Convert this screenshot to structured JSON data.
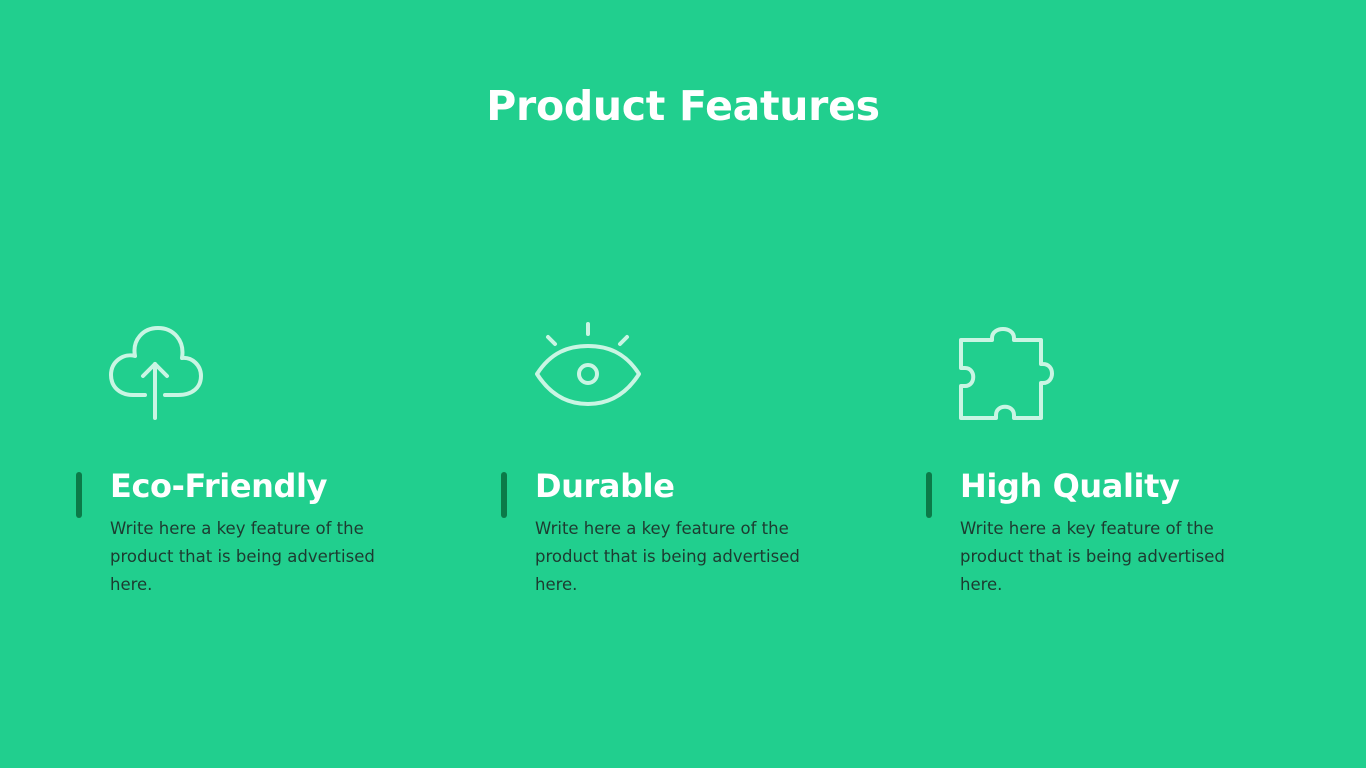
{
  "slide": {
    "title": "Product Features",
    "background_color": "#21cf8e",
    "accent_color": "#0b7a48",
    "icon_color": "#c9f5e3"
  },
  "features": [
    {
      "icon": "cloud-upload-icon",
      "heading": "Eco-Friendly",
      "description": "Write here a key feature of the product that is being advertised here."
    },
    {
      "icon": "eye-icon",
      "heading": "Durable",
      "description": "Write here a key feature of the product that is being advertised here."
    },
    {
      "icon": "puzzle-piece-icon",
      "heading": "High Quality",
      "description": "Write here a key feature of the product that is being advertised here."
    }
  ]
}
